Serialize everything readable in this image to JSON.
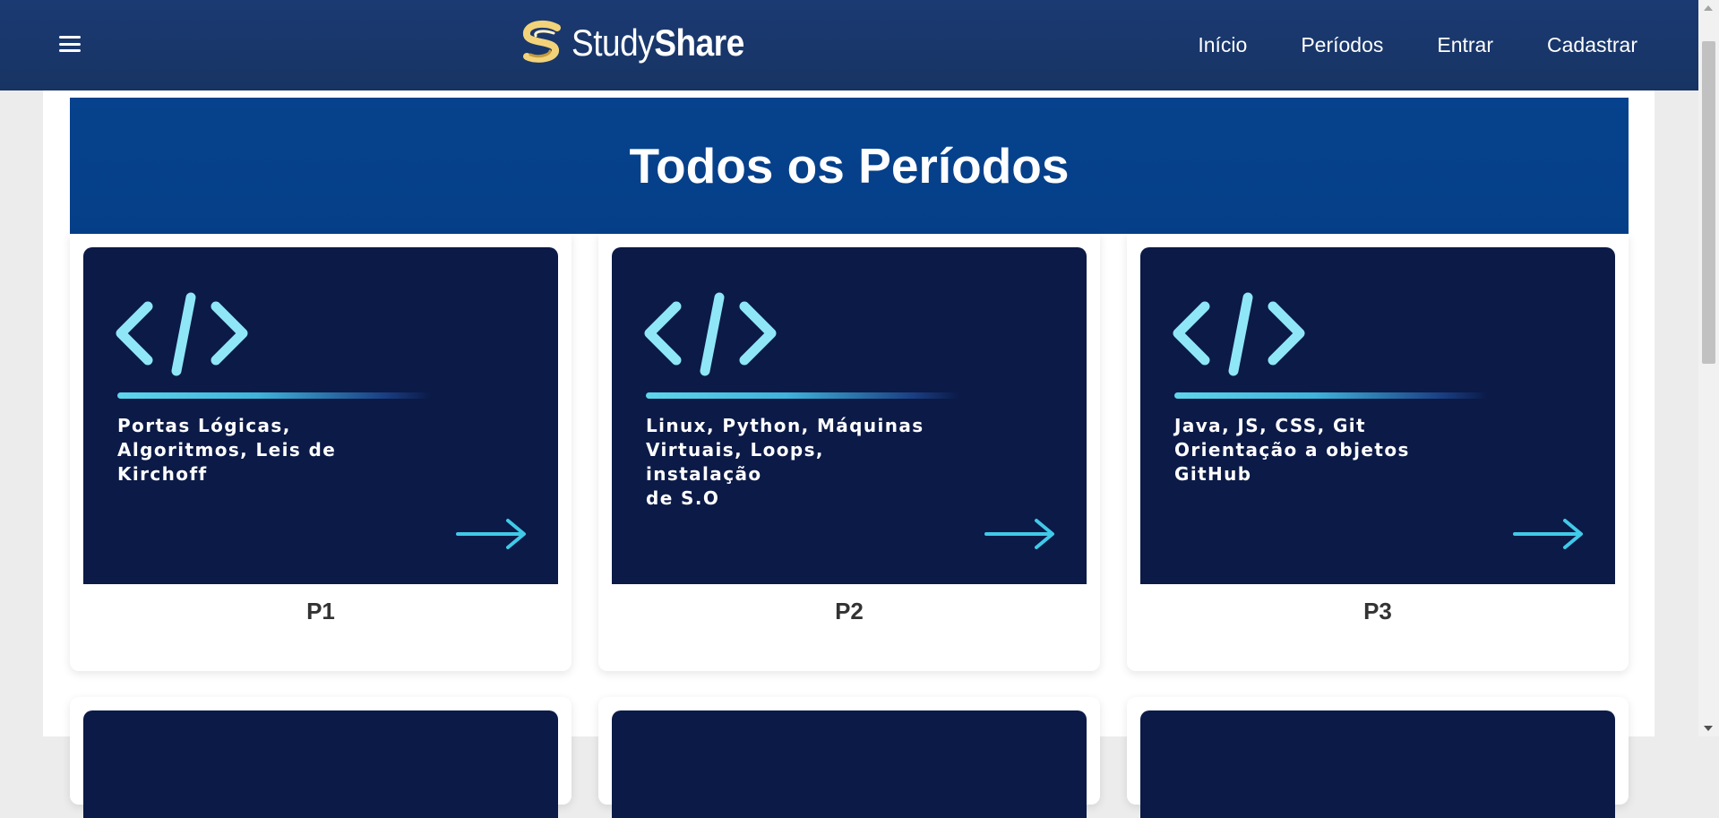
{
  "navbar": {
    "brand": {
      "prefix": "Study",
      "suffix": "Share"
    },
    "links": [
      "Início",
      "Períodos",
      "Entrar",
      "Cadastrar"
    ]
  },
  "hero": {
    "title": "Todos os Períodos"
  },
  "cards": [
    {
      "title": "P1",
      "description": "Portas Lógicas,\nAlgoritmos,  Leis de\nKirchoff"
    },
    {
      "title": "P2",
      "description": "Linux, Python, Máquinas\nVirtuais, Loops, instalação\nde S.O"
    },
    {
      "title": "P3",
      "description": "Java,  JS,  CSS,  Git\nOrientação a objetos\nGitHub"
    }
  ],
  "colors": {
    "navbar": "#1b3a73",
    "hero": "#06428d",
    "card_image_bg": "#0b1a47",
    "accent_cyan": "#5fd6ec",
    "logo_yellow": "#f2d37a"
  },
  "icons": [
    "hamburger-icon",
    "studyshare-logo-icon",
    "code-brackets-icon",
    "arrow-right-icon"
  ]
}
